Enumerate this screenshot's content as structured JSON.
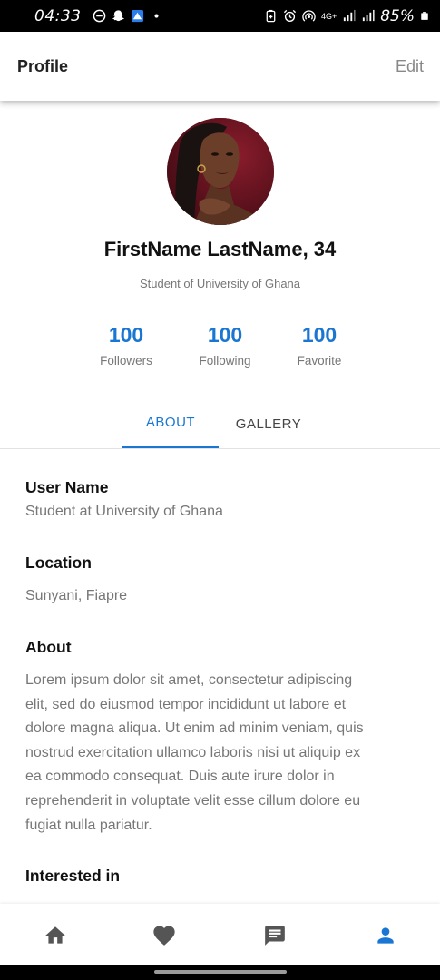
{
  "status_bar": {
    "time": "04:33",
    "network": "4G+",
    "battery": "85%",
    "left_icons": [
      "do-not-disturb-icon",
      "snapchat-icon",
      "app-notification-icon",
      "dot-icon"
    ],
    "right_icons": [
      "battery-saver-icon",
      "alarm-icon",
      "hotspot-icon",
      "signal-icon",
      "signal-icon",
      "battery-icon"
    ]
  },
  "app_bar": {
    "title": "Profile",
    "edit_label": "Edit"
  },
  "profile": {
    "name": "FirstName LastName, 34",
    "subtitle": "Student of University of Ghana"
  },
  "stats": [
    {
      "value": "100",
      "label": "Followers"
    },
    {
      "value": "100",
      "label": "Following"
    },
    {
      "value": "100",
      "label": "Favorite"
    }
  ],
  "tabs": [
    {
      "label": "ABOUT",
      "active": true
    },
    {
      "label": "GALLERY",
      "active": false
    }
  ],
  "sections": {
    "username": {
      "title": "User Name",
      "value": "Student at University of Ghana"
    },
    "location": {
      "title": "Location",
      "value": "Sunyani, Fiapre"
    },
    "about": {
      "title": "About",
      "lines": [
        "Lorem ipsum dolor sit amet, consectetur adipiscing",
        "elit, sed do eiusmod tempor incididunt ut labore et",
        "dolore magna aliqua. Ut enim ad minim veniam, quis",
        "nostrud exercitation ullamco laboris nisi ut aliquip ex",
        "ea commodo consequat. Duis aute irure dolor in",
        "reprehenderit in voluptate velit esse cillum dolore eu",
        "fugiat nulla pariatur."
      ]
    },
    "interested": {
      "title": "Interested in"
    }
  },
  "bottom_nav": [
    {
      "icon": "home-icon",
      "active": false
    },
    {
      "icon": "heart-icon",
      "active": false
    },
    {
      "icon": "chat-icon",
      "active": false
    },
    {
      "icon": "person-icon",
      "active": true
    }
  ],
  "colors": {
    "accent": "#1976d2",
    "muted_text": "#777777",
    "inactive_icon": "#555555"
  }
}
